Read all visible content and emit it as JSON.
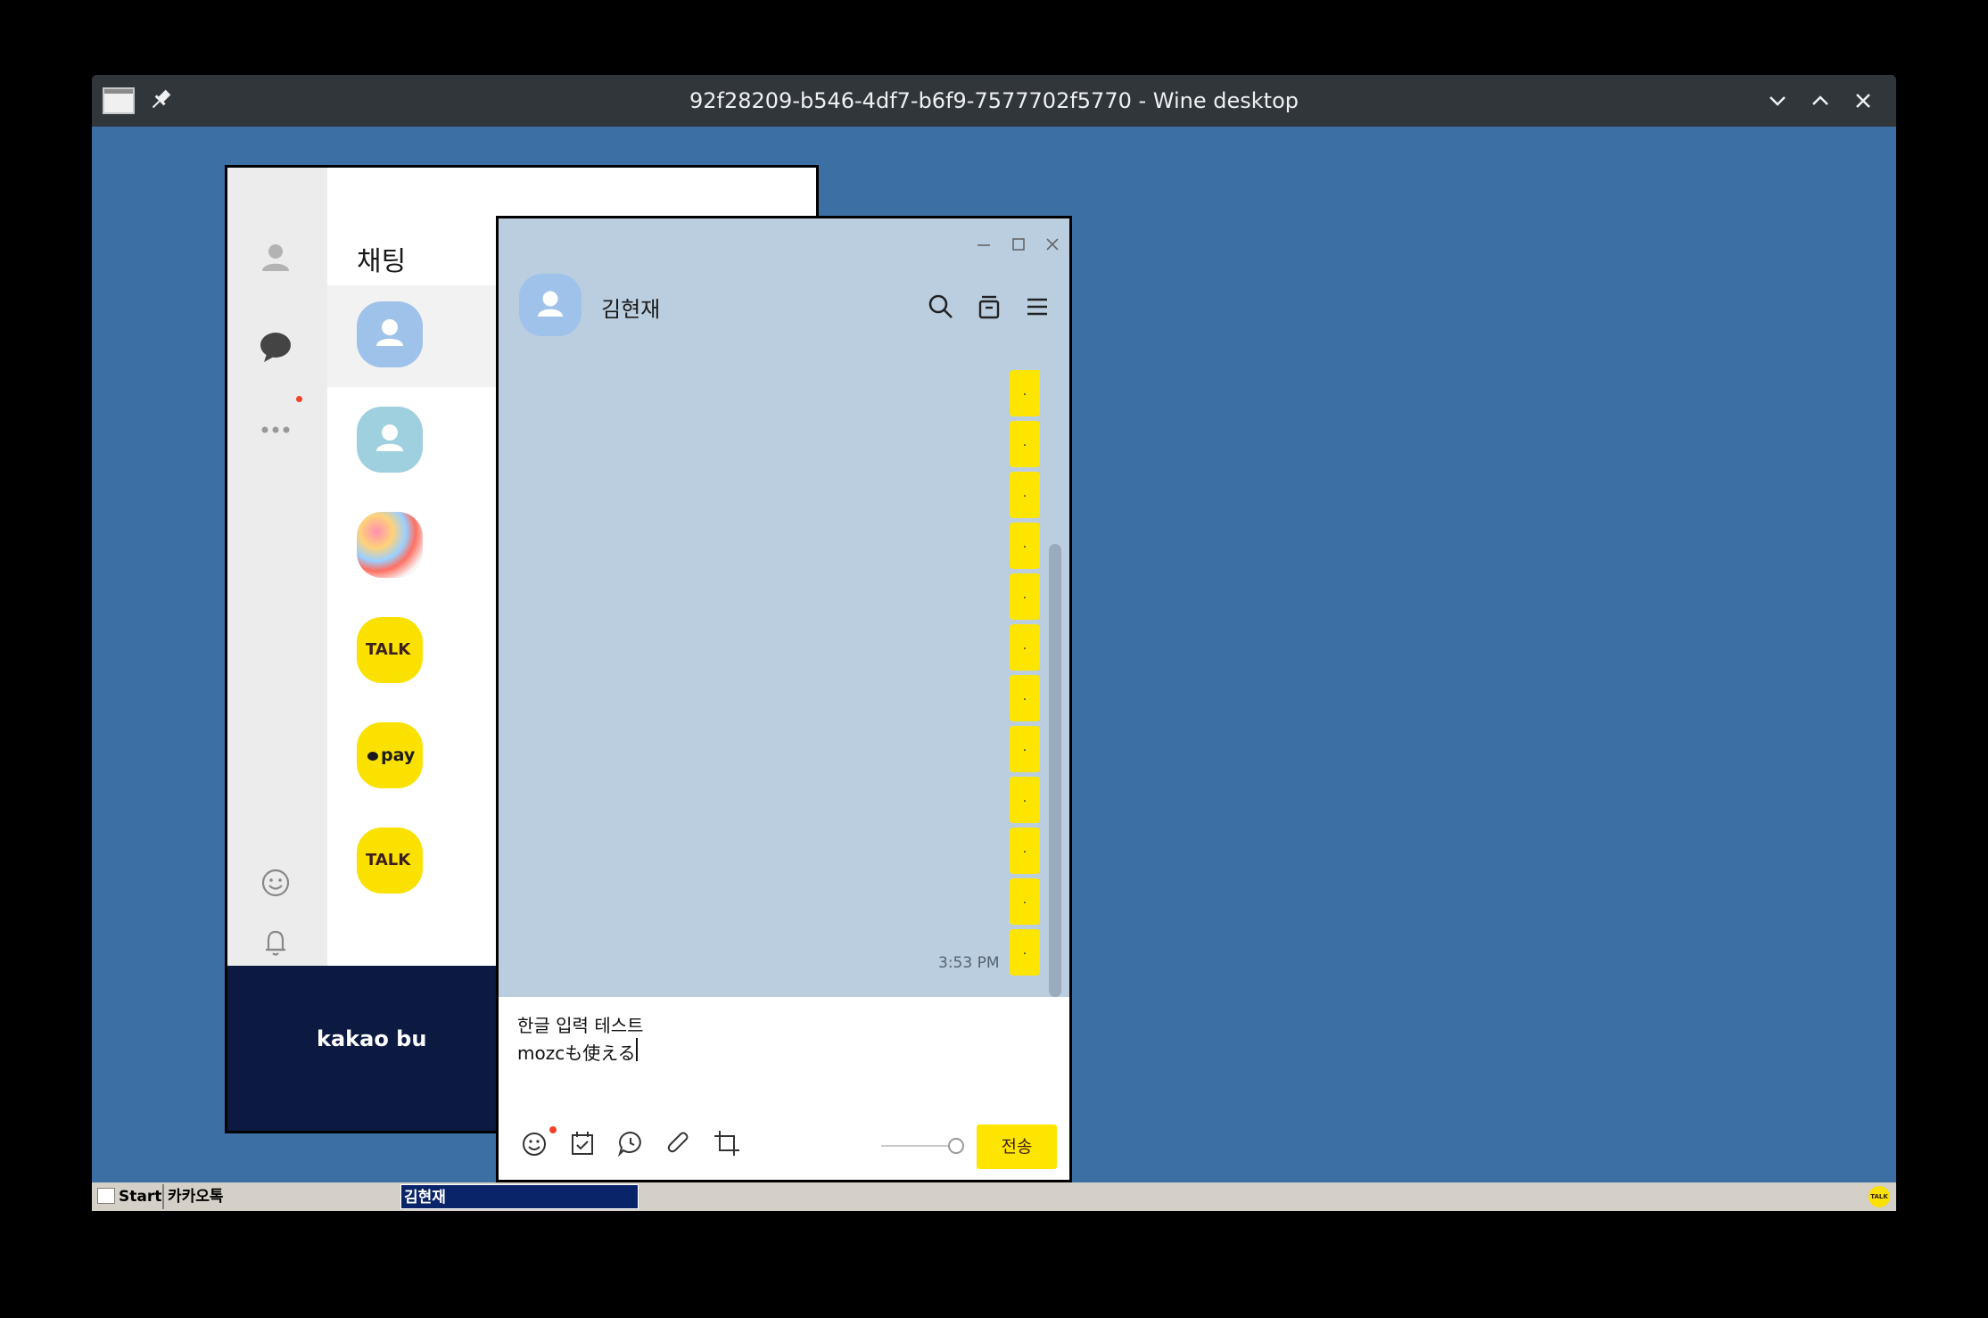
{
  "wine": {
    "title": "92f28209-b546-4df7-b6f9-7577702f5770 - Wine desktop",
    "icons": [
      "app-window-icon",
      "pin-icon",
      "chevron-down-icon",
      "chevron-up-icon",
      "close-icon"
    ]
  },
  "kakao_main": {
    "heading": "채팅",
    "sidebar_icons": [
      "friends-icon",
      "chat-icon",
      "more-icon",
      "emoticon-icon",
      "bell-icon",
      "settings-icon"
    ],
    "chat_avatars": [
      {
        "type": "person",
        "label": ""
      },
      {
        "type": "person",
        "label": ""
      },
      {
        "type": "art",
        "label": ""
      },
      {
        "type": "talk",
        "label": "TALK"
      },
      {
        "type": "pay",
        "label": "pay"
      },
      {
        "type": "talk",
        "label": "TALK"
      }
    ],
    "banner_text": "kakao bu"
  },
  "chat_window": {
    "contact_name": "김현재",
    "header_icons": [
      "search-icon",
      "drawer-icon",
      "menu-icon"
    ],
    "messages": [
      ".",
      ".",
      ".",
      ".",
      ".",
      ".",
      ".",
      ".",
      ".",
      ".",
      ".",
      "."
    ],
    "last_time": "3:53 PM",
    "input_lines": [
      "한글 입력 테스트",
      "mozcも使える"
    ],
    "toolbar_icons": [
      "emoji-icon",
      "calendar-check-icon",
      "chat-bubble-icon",
      "paperclip-icon",
      "crop-icon"
    ],
    "send_label": "전송"
  },
  "taskbar": {
    "start_label": "Start",
    "tasks": [
      "카카오톡",
      "김현재"
    ],
    "tray_label": "TALK"
  },
  "colors": {
    "desktop": "#3c6fa4",
    "kakao_yellow": "#fee500",
    "chat_bg": "#bacee0",
    "titlebar": "#31363b"
  }
}
